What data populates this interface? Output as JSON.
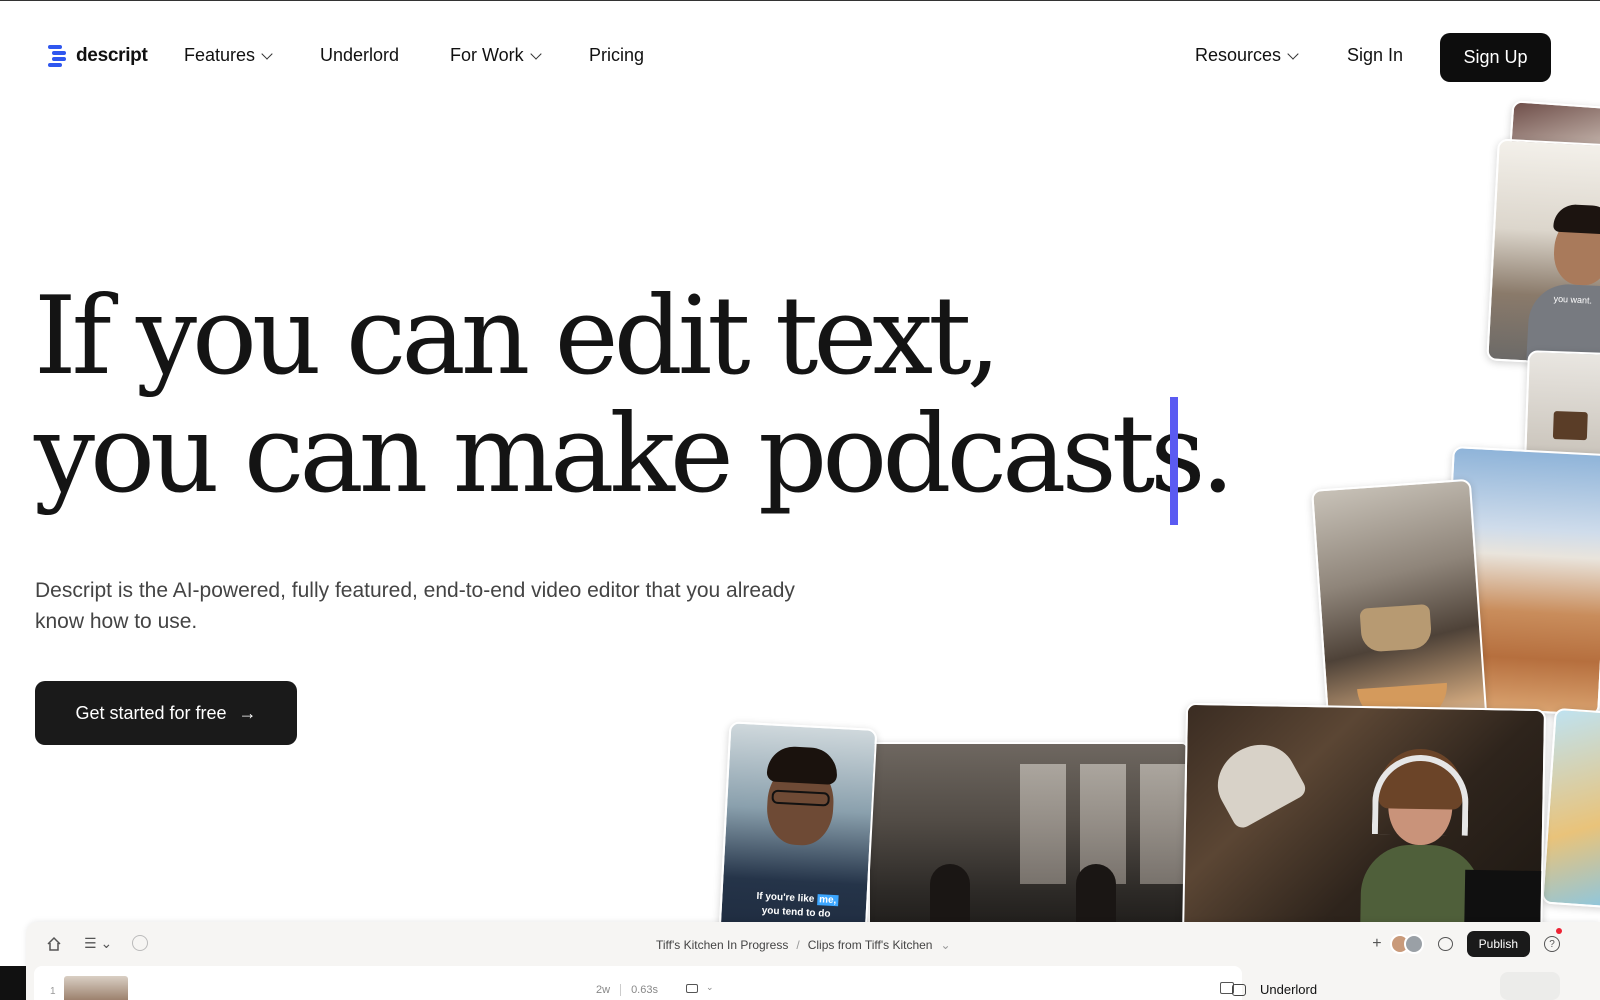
{
  "nav": {
    "brand": "descript",
    "items": [
      {
        "label": "Features",
        "has_dropdown": true
      },
      {
        "label": "Underlord",
        "has_dropdown": false
      },
      {
        "label": "For Work",
        "has_dropdown": true
      },
      {
        "label": "Pricing",
        "has_dropdown": false
      }
    ],
    "resources": "Resources",
    "sign_in": "Sign In",
    "sign_up": "Sign Up"
  },
  "hero": {
    "headline_line1": "If you can edit text,",
    "headline_line2": "you can make podcasts.",
    "subtitle": "Descript is the AI-powered, fully featured, end-to-end video editor that you already know how to use.",
    "cta": "Get started for free",
    "caret_color": "#5b5bf2"
  },
  "collage": {
    "man_caption": "you want.",
    "guy_caption_line1_a": "If you're like",
    "guy_caption_line1_b": "me,",
    "guy_caption_line2": "you tend to do"
  },
  "editor": {
    "breadcrumb": [
      "Tiff's Kitchen In Progress",
      "Clips from Tiff's Kitchen"
    ],
    "publish": "Publish",
    "help": "?",
    "row_number": "1",
    "meta": [
      "2w",
      "0.63s"
    ],
    "side_panel_title": "Underlord"
  },
  "icons": {
    "logo": "descript-logo-icon",
    "chevron": "chevron-down-icon",
    "arrow": "arrow-right-icon",
    "home": "home-icon",
    "menu": "menu-icon",
    "check": "check-circle-icon",
    "comment": "comment-icon",
    "help": "help-icon",
    "robot": "robot-icon"
  },
  "colors": {
    "brand": "#2f57ef",
    "cta_bg": "#1a1a1a",
    "signup_bg": "#0d0d0d"
  }
}
